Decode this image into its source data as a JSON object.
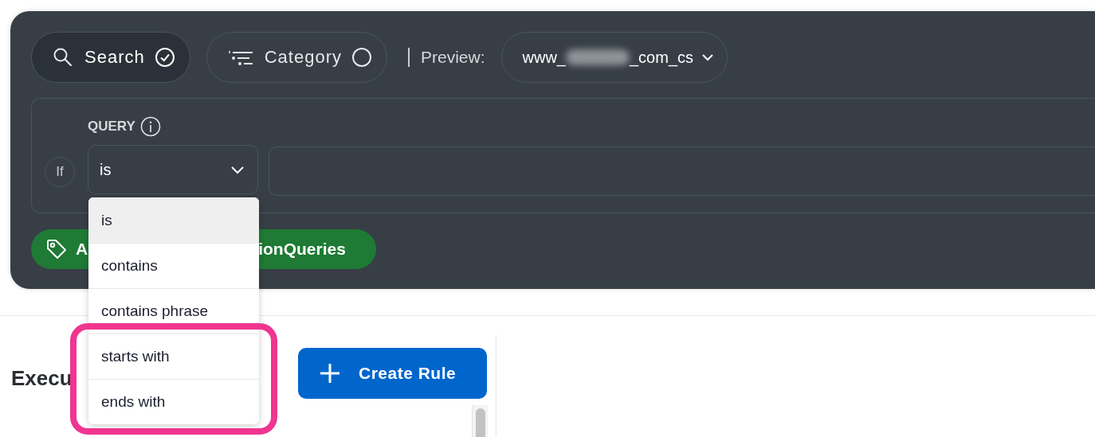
{
  "filters": [
    {
      "kind": "search",
      "label": "Search",
      "selected": true
    },
    {
      "kind": "category",
      "label": "Category",
      "selected": false
    }
  ],
  "preview": {
    "label": "Preview:",
    "value_start": "www_",
    "value_end": "_com_cs",
    "redacted": true
  },
  "condition": {
    "prefix": "If",
    "label": "QUERY",
    "operator": "is"
  },
  "operator_menu": {
    "expanded": true,
    "options": [
      {
        "label": "is",
        "selected": true,
        "highlighted": false
      },
      {
        "label": "contains",
        "selected": false,
        "highlighted": false
      },
      {
        "label": "contains phrase",
        "selected": false,
        "highlighted": false
      },
      {
        "label": "starts with",
        "selected": false,
        "highlighted": true
      },
      {
        "label": "ends with",
        "selected": false,
        "highlighted": true
      }
    ]
  },
  "tag": {
    "text_start": "A",
    "text_end": "ionQueries"
  },
  "section": {
    "heading": "Execu"
  },
  "create_button": {
    "label": "Create Rule"
  }
}
